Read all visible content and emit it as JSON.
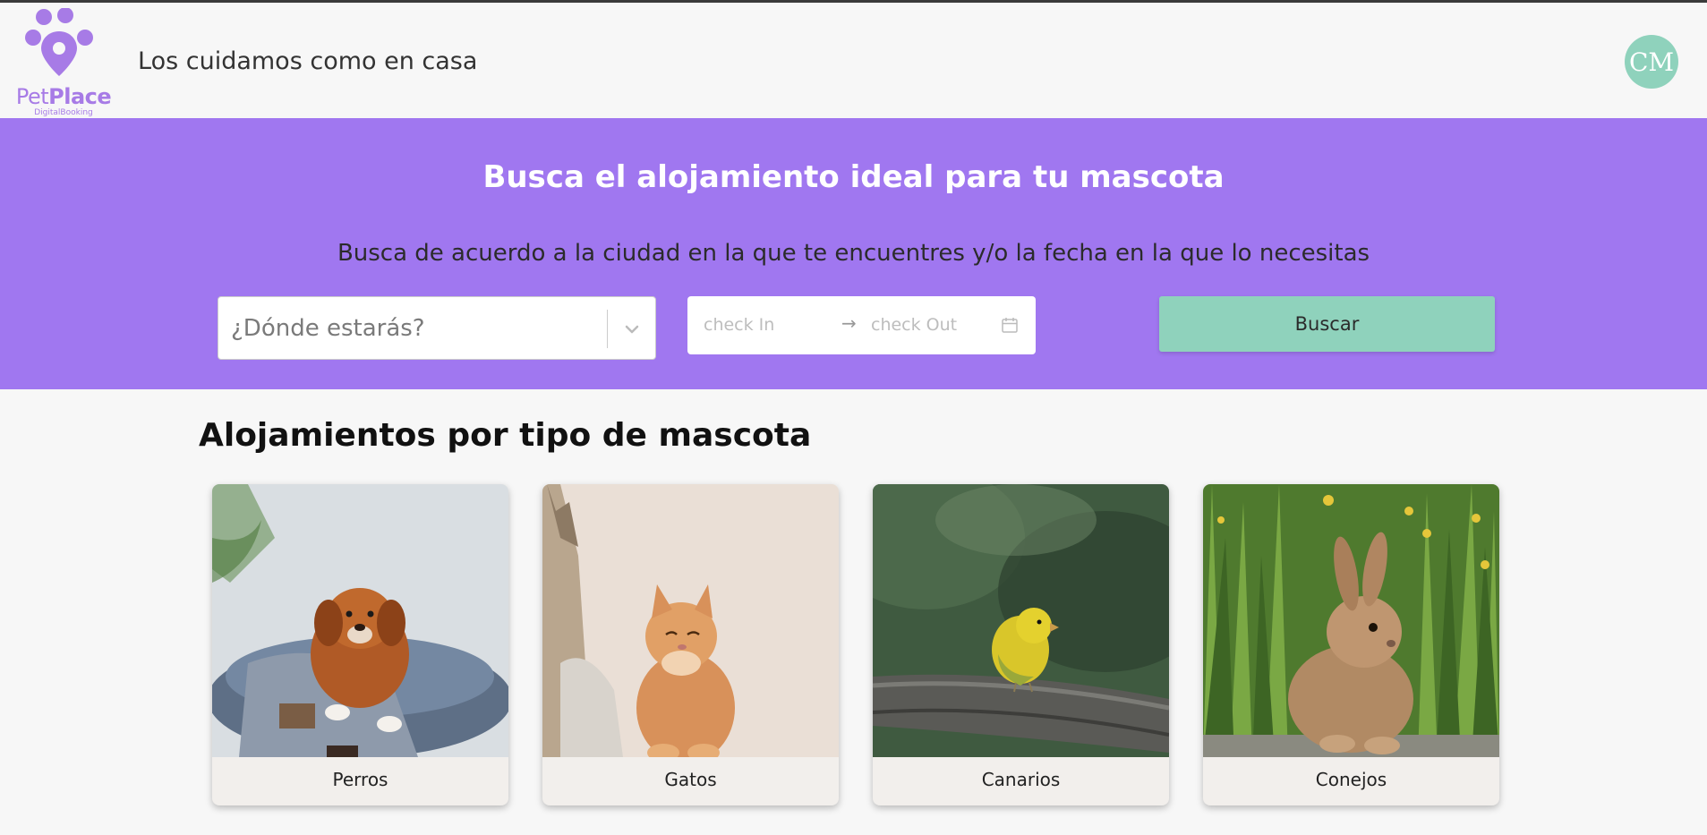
{
  "header": {
    "brand_pet": "Pet",
    "brand_place": "Place",
    "brand_sub": "DigitalBooking",
    "tagline": "Los cuidamos como en casa",
    "avatar_initials": "CM"
  },
  "hero": {
    "title": "Busca el alojamiento ideal para tu mascota",
    "description": "Busca de acuerdo a la ciudad en la que te encuentres y/o la fecha en la que lo necesitas",
    "destination_placeholder": "¿Dónde estarás?",
    "check_in_placeholder": "check In",
    "check_out_placeholder": "check Out",
    "search_button": "Buscar"
  },
  "section": {
    "title": "Alojamientos por tipo de mascota"
  },
  "categories": [
    {
      "label": "Perros"
    },
    {
      "label": "Gatos"
    },
    {
      "label": "Canarios"
    },
    {
      "label": "Conejos"
    }
  ],
  "colors": {
    "accent_purple": "#a077f0",
    "accent_mint": "#8fd2bc",
    "logo_purple": "#a77be6"
  }
}
